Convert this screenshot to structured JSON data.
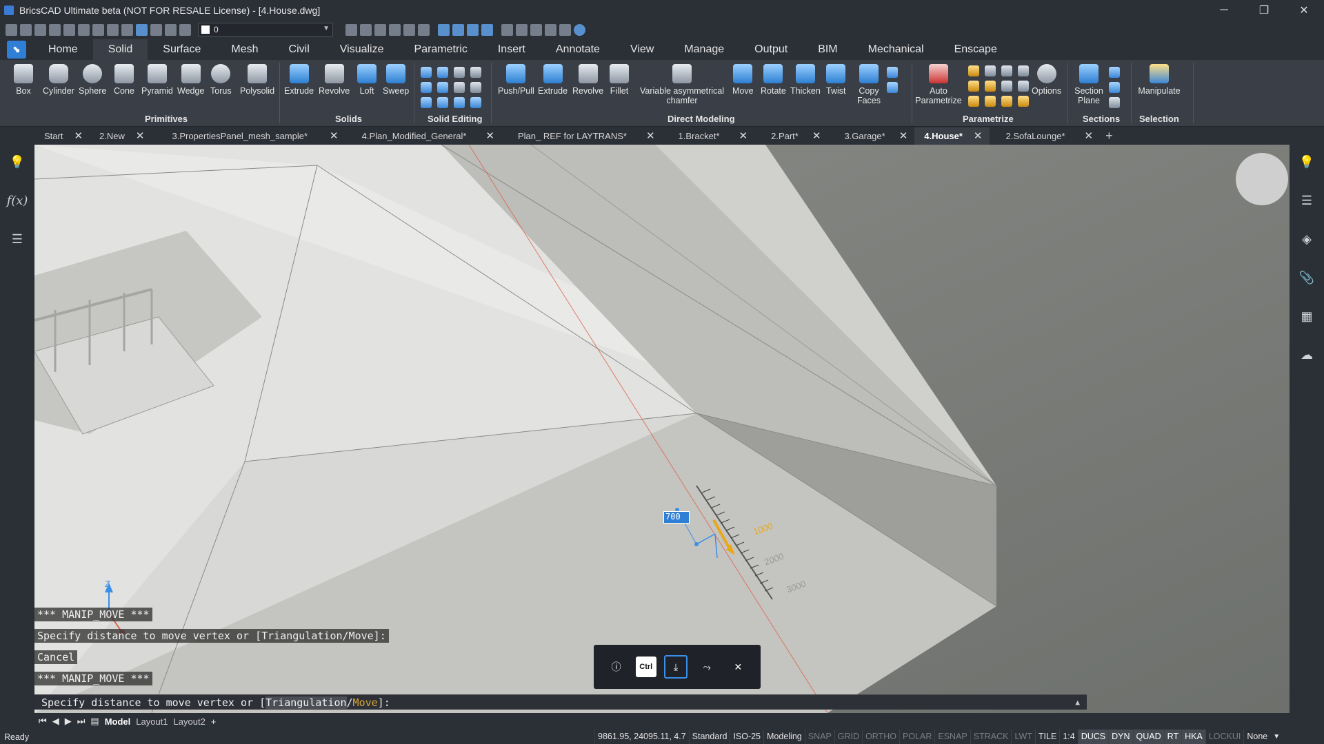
{
  "window": {
    "title": "BricsCAD Ultimate beta (NOT FOR RESALE License) - [4.House.dwg]",
    "controls": [
      "─",
      "❐",
      "✕"
    ]
  },
  "qat": {
    "layer_value": "0"
  },
  "menu": {
    "tabs": [
      "Home",
      "Solid",
      "Surface",
      "Mesh",
      "Civil",
      "Visualize",
      "Parametric",
      "Insert",
      "Annotate",
      "View",
      "Manage",
      "Output",
      "BIM",
      "Mechanical",
      "Enscape"
    ],
    "active": "Solid"
  },
  "ribbon": {
    "primitives": [
      "Box",
      "Cylinder",
      "Sphere",
      "Cone",
      "Pyramid",
      "Wedge",
      "Torus",
      "Polysolid"
    ],
    "solids": [
      "Extrude",
      "Revolve",
      "Loft",
      "Sweep"
    ],
    "direct_modeling": [
      "Push/Pull",
      "Extrude",
      "Revolve",
      "Fillet",
      "Variable asymmetrical chamfer",
      "Move",
      "Rotate",
      "Thicken",
      "Twist",
      "Copy Faces"
    ],
    "parametrize": [
      "Auto Parametrize",
      "Options"
    ],
    "sections": [
      "Section Plane"
    ],
    "selection": [
      "Manipulate"
    ],
    "groups": [
      "Primitives",
      "Solids",
      "Solid Editing",
      "Direct Modeling",
      "Parametrize",
      "Sections",
      "Selection"
    ]
  },
  "doctabs": [
    {
      "label": "Start"
    },
    {
      "label": "2.New"
    },
    {
      "label": "3.PropertiesPanel_mesh_sample*"
    },
    {
      "label": "4.Plan_Modified_General*"
    },
    {
      "label": "Plan_ REF for LAYTRANS*"
    },
    {
      "label": "1.Bracket*"
    },
    {
      "label": "2.Part*"
    },
    {
      "label": "3.Garage*"
    },
    {
      "label": "4.House*"
    },
    {
      "label": "2.SofaLounge*"
    }
  ],
  "viewport": {
    "dim_value": "700",
    "ruler_labels": [
      "1000",
      "2000",
      "3000"
    ],
    "axis_label": "Z"
  },
  "commands": {
    "line1": "*** MANIP_MOVE ***",
    "line2": "Specify distance to move vertex or [Triangulation/Move]:",
    "line3": "Cancel",
    "line4": "*** MANIP_MOVE ***",
    "prompt_prefix": "Specify distance to move vertex or [",
    "opt1": "Triangulation",
    "slash": "/",
    "opt2": "Move",
    "prompt_suffix": "]:"
  },
  "quad": {
    "ctrl": "Ctrl",
    "info": "ⓘ",
    "close": "✕"
  },
  "layouts": [
    "Model",
    "Layout1",
    "Layout2"
  ],
  "status": {
    "ready": "Ready",
    "coords": "9861.95, 24095.11, 4.7",
    "items": [
      {
        "label": "Standard",
        "state": "normal"
      },
      {
        "label": "ISO-25",
        "state": "normal"
      },
      {
        "label": "Modeling",
        "state": "normal"
      },
      {
        "label": "SNAP",
        "state": "off"
      },
      {
        "label": "GRID",
        "state": "off"
      },
      {
        "label": "ORTHO",
        "state": "off"
      },
      {
        "label": "POLAR",
        "state": "off"
      },
      {
        "label": "ESNAP",
        "state": "off"
      },
      {
        "label": "STRACK",
        "state": "off"
      },
      {
        "label": "LWT",
        "state": "off"
      },
      {
        "label": "TILE",
        "state": "normal"
      },
      {
        "label": "1:4",
        "state": "normal"
      },
      {
        "label": "DUCS",
        "state": "on"
      },
      {
        "label": "DYN",
        "state": "on"
      },
      {
        "label": "QUAD",
        "state": "on"
      },
      {
        "label": "RT",
        "state": "on"
      },
      {
        "label": "HKA",
        "state": "on"
      },
      {
        "label": "LOCKUI",
        "state": "off"
      },
      {
        "label": "None",
        "state": "normal"
      }
    ]
  }
}
